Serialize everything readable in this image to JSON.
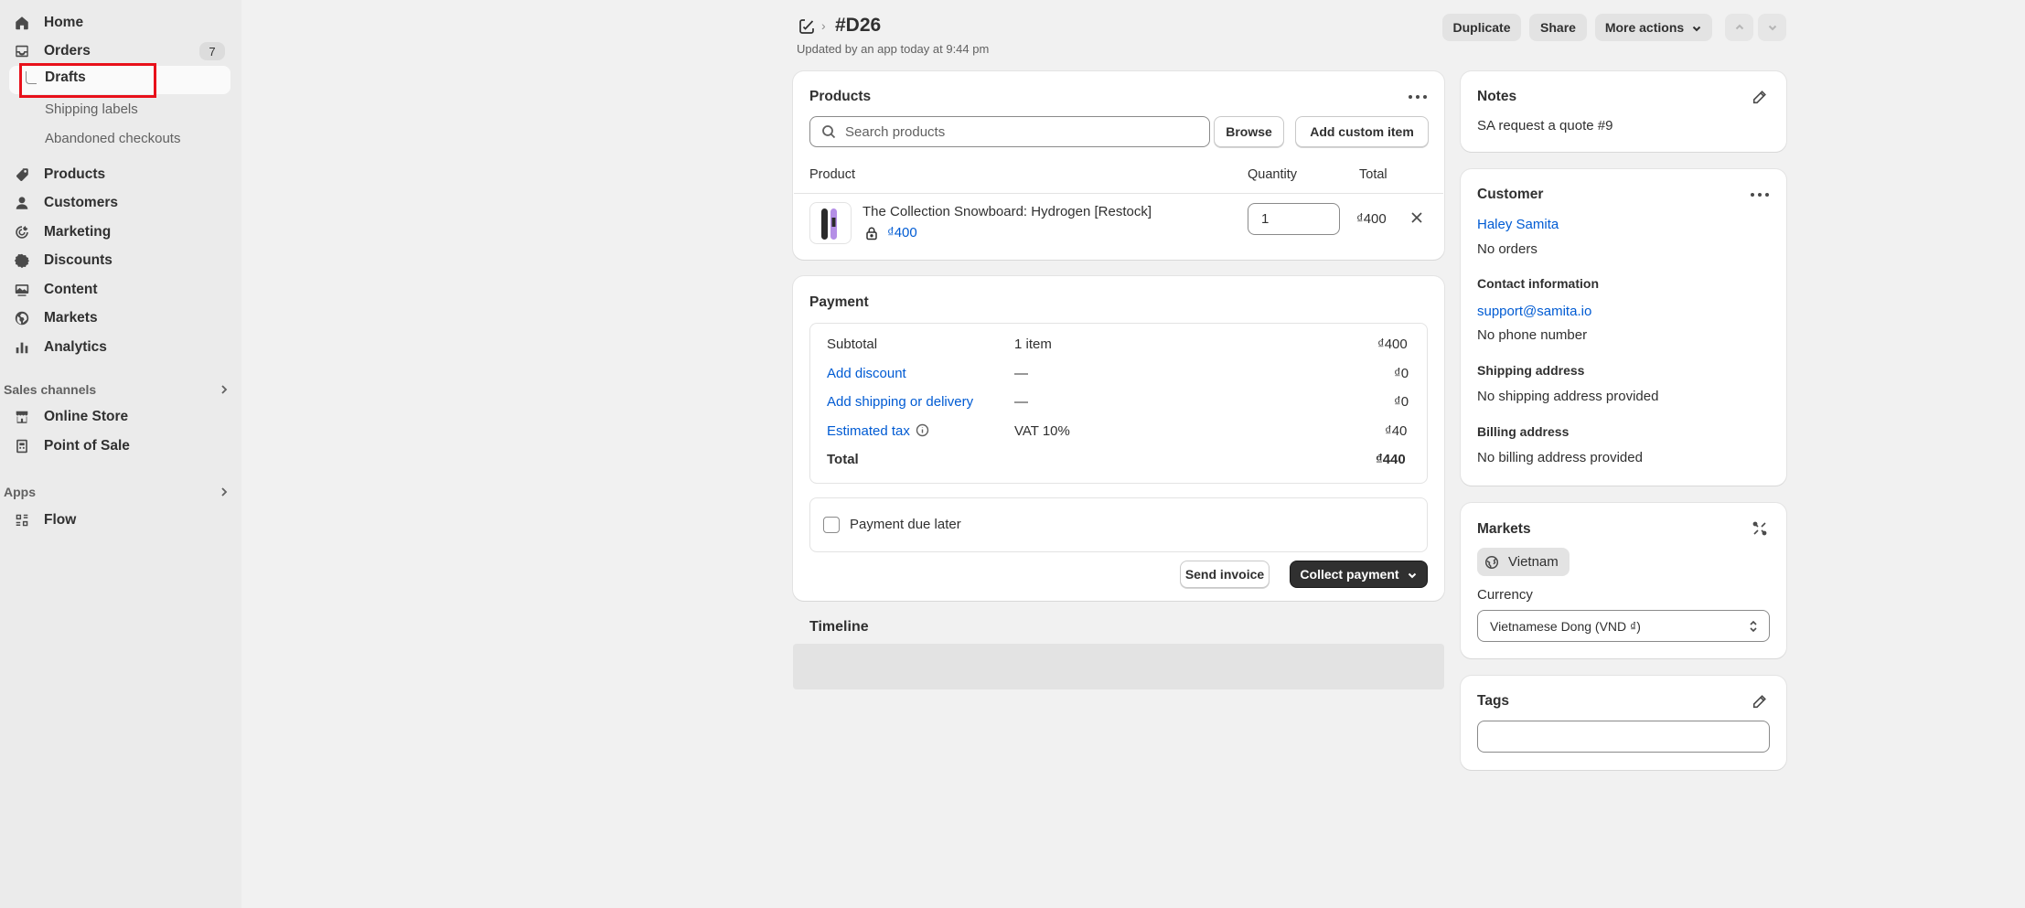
{
  "sidebar": {
    "items": [
      {
        "label": "Home",
        "icon": "home-icon"
      },
      {
        "label": "Orders",
        "icon": "inbox-icon",
        "badge": "7"
      },
      {
        "label": "Products",
        "icon": "tag-icon"
      },
      {
        "label": "Customers",
        "icon": "person-icon"
      },
      {
        "label": "Marketing",
        "icon": "target-icon"
      },
      {
        "label": "Discounts",
        "icon": "discount-icon"
      },
      {
        "label": "Content",
        "icon": "content-icon"
      },
      {
        "label": "Markets",
        "icon": "globe-icon"
      },
      {
        "label": "Analytics",
        "icon": "bar-chart-icon"
      }
    ],
    "order_subitems": [
      "Drafts",
      "Shipping labels",
      "Abandoned checkouts"
    ],
    "sales_channels_label": "Sales channels",
    "sales_channels": [
      "Online Store",
      "Point of Sale"
    ],
    "apps_label": "Apps",
    "apps": [
      "Flow"
    ]
  },
  "header": {
    "title": "#D26",
    "subtitle": "Updated by an app today at 9:44 pm",
    "duplicate_label": "Duplicate",
    "share_label": "Share",
    "more_actions_label": "More actions"
  },
  "products_card": {
    "title": "Products",
    "search_placeholder": "Search products",
    "browse_label": "Browse",
    "add_custom_label": "Add custom item",
    "columns": [
      "Product",
      "Quantity",
      "Total"
    ],
    "line_item": {
      "name": "The Collection Snowboard: Hydrogen [Restock]",
      "price": "₫400",
      "quantity": "1",
      "total": "₫400"
    }
  },
  "payment_card": {
    "title": "Payment",
    "rows": [
      {
        "label": "Subtotal",
        "detail": "1 item",
        "amount": "₫400"
      },
      {
        "label": "Add discount",
        "detail": "—",
        "amount": "₫0"
      },
      {
        "label": "Add shipping or delivery",
        "detail": "—",
        "amount": "₫0"
      },
      {
        "label": "Estimated tax",
        "detail": "VAT 10%",
        "amount": "₫40"
      },
      {
        "label": "Total",
        "detail": "",
        "amount": "₫440"
      }
    ],
    "payment_due_later_label": "Payment due later",
    "send_invoice_label": "Send invoice",
    "collect_payment_label": "Collect payment"
  },
  "timeline": {
    "title": "Timeline"
  },
  "notes_card": {
    "title": "Notes",
    "text": "SA request a quote #9"
  },
  "customer_card": {
    "title": "Customer",
    "name": "Haley Samita",
    "orders": "No orders",
    "contact_heading": "Contact information",
    "email": "support@samita.io",
    "phone": "No phone number",
    "shipping_heading": "Shipping address",
    "shipping": "No shipping address provided",
    "billing_heading": "Billing address",
    "billing": "No billing address provided"
  },
  "markets_card": {
    "title": "Markets",
    "market": "Vietnam",
    "currency_label": "Currency",
    "currency_value": "Vietnamese Dong (VND ₫)"
  },
  "tags_card": {
    "title": "Tags"
  },
  "colors": {
    "accent_link": "#005bd3",
    "primary_button": "#303030",
    "highlight_box": "#e8101a"
  }
}
